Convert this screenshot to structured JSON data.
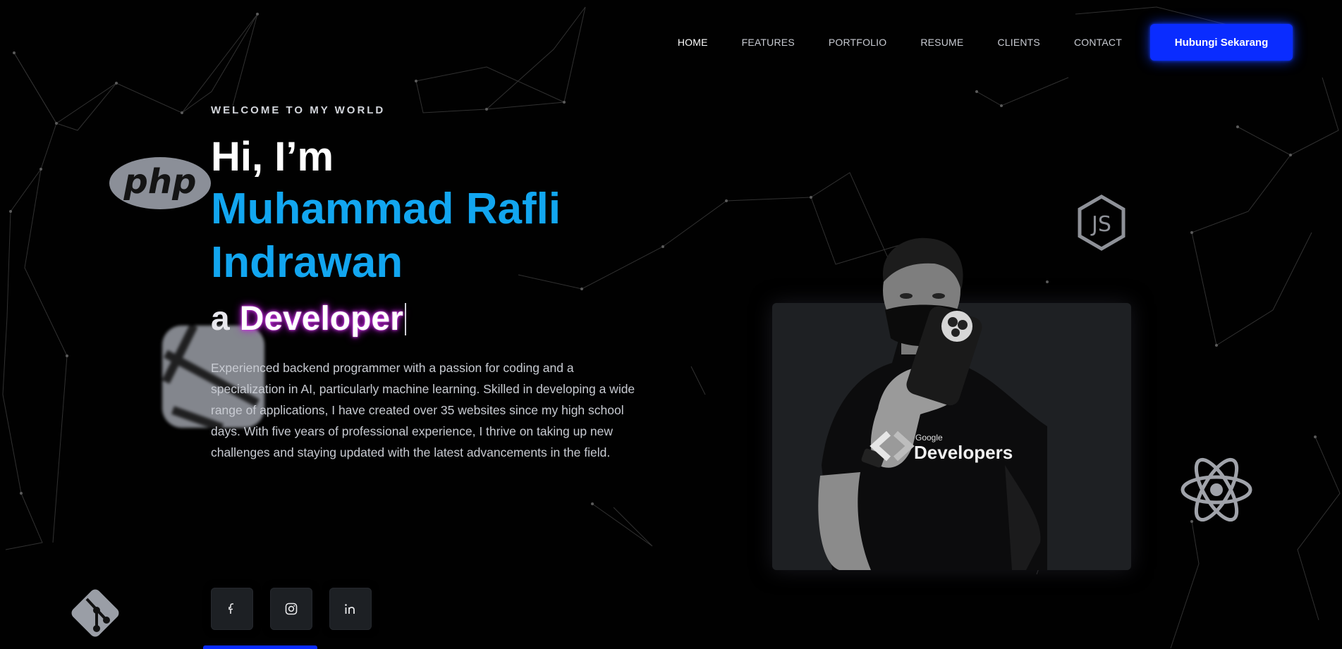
{
  "nav": {
    "items": [
      {
        "label": "HOME",
        "active": true
      },
      {
        "label": "FEATURES",
        "active": false
      },
      {
        "label": "PORTFOLIO",
        "active": false
      },
      {
        "label": "RESUME",
        "active": false
      },
      {
        "label": "CLIENTS",
        "active": false
      },
      {
        "label": "CONTACT",
        "active": false
      }
    ],
    "cta_label": "Hubungi Sekarang"
  },
  "hero": {
    "eyebrow": "WELCOME TO MY WORLD",
    "greeting": "Hi, I’m",
    "name_line1": "Muhammad Rafli",
    "name_line2": "Indrawan",
    "role_prefix": "a",
    "role_word": "Developer",
    "description": "Experienced backend programmer with a passion for coding and a specialization in AI, particularly machine learning. Skilled in developing a wide range of applications, I have created over 35 websites since my high school days. With five years of professional experience, I thrive on taking up new challenges and staying updated with the latest advancements in the field."
  },
  "socials": [
    {
      "icon": "facebook-icon"
    },
    {
      "icon": "instagram-icon"
    },
    {
      "icon": "linkedin-icon"
    }
  ],
  "photo": {
    "shirt_text_small": "Google",
    "shirt_text_large": "Developers"
  },
  "floating_icons": {
    "php_label": "php",
    "js_label": "JS",
    "other_icons": [
      "laravel-icon",
      "git-icon",
      "react-icon"
    ]
  },
  "colors": {
    "accent_blue": "#0a2cff",
    "name_color": "#12a6f0",
    "glow_purple": "#c02bd8",
    "background": "#010101"
  }
}
